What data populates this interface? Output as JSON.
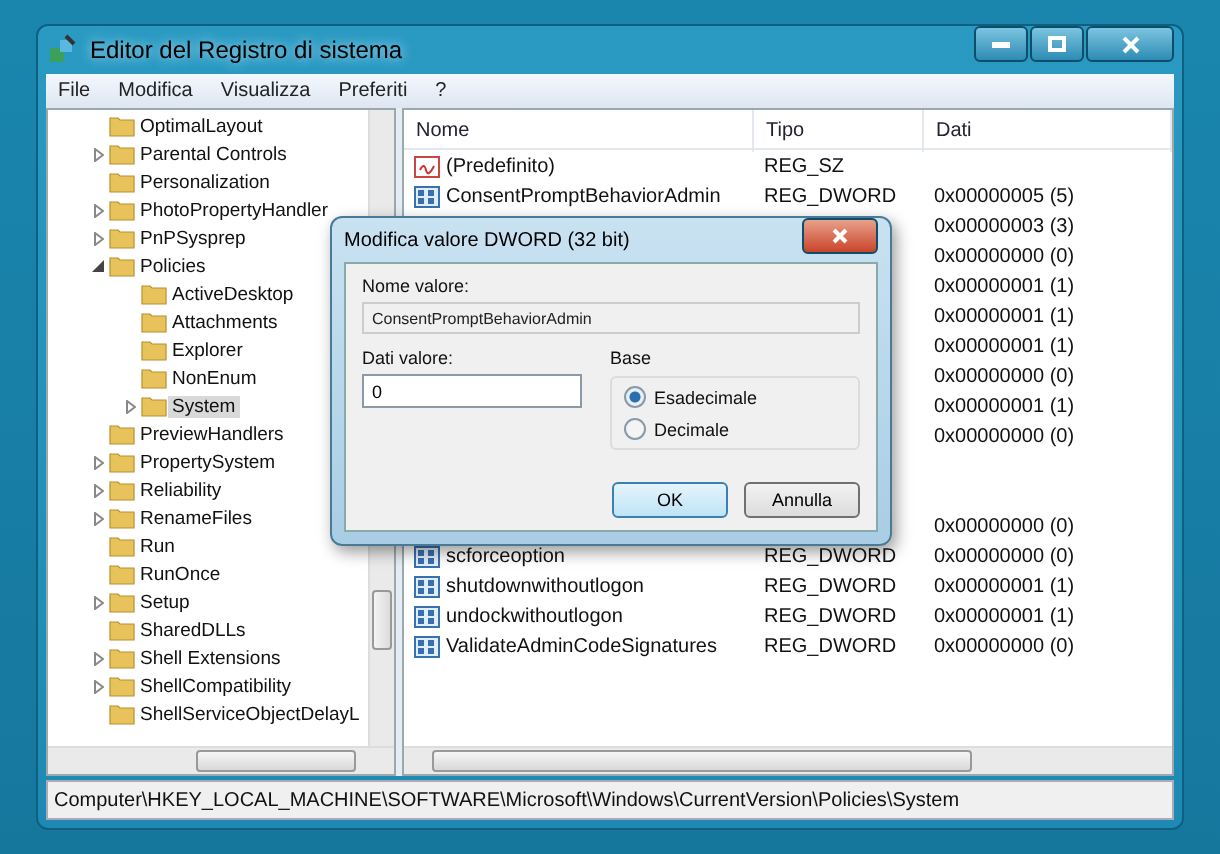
{
  "window": {
    "title": "Editor del Registro di sistema"
  },
  "menu": [
    "File",
    "Modifica",
    "Visualizza",
    "Preferiti",
    "?"
  ],
  "tree": [
    {
      "label": "OptimalLayout",
      "selected": false
    },
    {
      "label": "Parental Controls",
      "expanded": false,
      "selected": false
    },
    {
      "label": "Personalization",
      "selected": false
    },
    {
      "label": "PhotoPropertyHandler",
      "expanded": false,
      "selected": false
    },
    {
      "label": "PnPSysprep",
      "expanded": false,
      "selected": false
    },
    {
      "label": "Policies",
      "expanded": true,
      "selected": false,
      "children": [
        {
          "label": "ActiveDesktop",
          "selected": false
        },
        {
          "label": "Attachments",
          "selected": false
        },
        {
          "label": "Explorer",
          "selected": false
        },
        {
          "label": "NonEnum",
          "selected": false
        },
        {
          "label": "System",
          "expanded": false,
          "selected": true
        }
      ]
    },
    {
      "label": "PreviewHandlers",
      "selected": false
    },
    {
      "label": "PropertySystem",
      "expanded": false,
      "selected": false
    },
    {
      "label": "Reliability",
      "expanded": false,
      "selected": false
    },
    {
      "label": "RenameFiles",
      "expanded": false,
      "selected": false
    },
    {
      "label": "Run",
      "selected": false
    },
    {
      "label": "RunOnce",
      "selected": false
    },
    {
      "label": "Setup",
      "expanded": false,
      "selected": false
    },
    {
      "label": "SharedDLLs",
      "selected": false
    },
    {
      "label": "Shell Extensions",
      "expanded": false,
      "selected": false
    },
    {
      "label": "ShellCompatibility",
      "expanded": false,
      "selected": false
    },
    {
      "label": "ShellServiceObjectDelayL",
      "selected": false
    }
  ],
  "list": {
    "columns": [
      "Nome",
      "Tipo",
      "Dati"
    ],
    "rows": [
      {
        "kind": "string",
        "name": "(Predefinito)",
        "type": "REG_SZ"
      },
      {
        "kind": "dword",
        "name": "ConsentPromptBehaviorAdmin",
        "type": "REG_DWORD",
        "data": "0x00000005 (5)"
      },
      {
        "kind": "hidden",
        "data": "0x00000003 (3)"
      },
      {
        "kind": "hidden",
        "data": "0x00000000 (0)"
      },
      {
        "kind": "hidden",
        "data": "0x00000001 (1)"
      },
      {
        "kind": "hidden",
        "data": "0x00000001 (1)"
      },
      {
        "kind": "hidden",
        "data": "0x00000001 (1)"
      },
      {
        "kind": "hidden",
        "data": "0x00000000 (0)"
      },
      {
        "kind": "hidden",
        "data": "0x00000001 (1)"
      },
      {
        "kind": "hidden",
        "data": "0x00000000 (0)"
      },
      {
        "kind": "hidden"
      },
      {
        "kind": "hidden"
      },
      {
        "kind": "hidden",
        "data": "0x00000000 (0)"
      },
      {
        "kind": "dword",
        "name": "scforceoption",
        "type": "REG_DWORD",
        "data": "0x00000000 (0)"
      },
      {
        "kind": "dword",
        "name": "shutdownwithoutlogon",
        "type": "REG_DWORD",
        "data": "0x00000001 (1)"
      },
      {
        "kind": "dword",
        "name": "undockwithoutlogon",
        "type": "REG_DWORD",
        "data": "0x00000001 (1)"
      },
      {
        "kind": "dword",
        "name": "ValidateAdminCodeSignatures",
        "type": "REG_DWORD",
        "data": "0x00000000 (0)"
      }
    ]
  },
  "status_bar": "Computer\\HKEY_LOCAL_MACHINE\\SOFTWARE\\Microsoft\\Windows\\CurrentVersion\\Policies\\System",
  "dialog": {
    "title": "Modifica valore DWORD (32 bit)",
    "name_label": "Nome valore:",
    "name_value": "ConsentPromptBehaviorAdmin",
    "data_label": "Dati valore:",
    "data_value": "0",
    "base_label": "Base",
    "bases": [
      {
        "label": "Esadecimale",
        "selected": true
      },
      {
        "label": "Decimale",
        "selected": false
      }
    ],
    "buttons": [
      {
        "label": "OK",
        "default": true
      },
      {
        "label": "Annulla",
        "default": false
      }
    ]
  }
}
